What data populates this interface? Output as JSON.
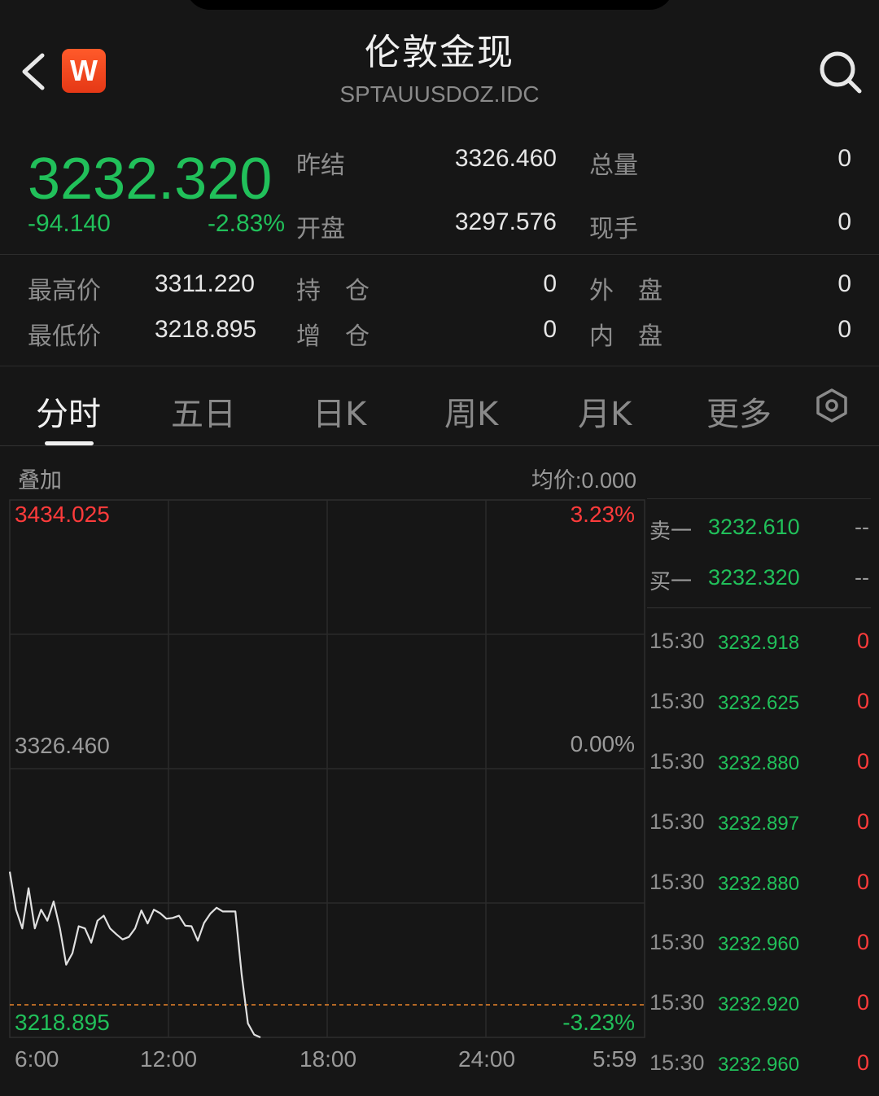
{
  "header": {
    "title": "伦敦金现",
    "subtitle": "SPTAUUSDOZ.IDC",
    "logo_letter": "W"
  },
  "quote": {
    "price": "3232.320",
    "change": "-94.140",
    "change_pct": "-2.83%",
    "fields": [
      {
        "label": "昨结",
        "value": "3326.460"
      },
      {
        "label": "总量",
        "value": "0"
      },
      {
        "label": "开盘",
        "value": "3297.576"
      },
      {
        "label": "现手",
        "value": "0"
      },
      {
        "label": "最高价",
        "value": "3311.220"
      },
      {
        "label": "持　仓",
        "value": "0"
      },
      {
        "label": "外　盘",
        "value": "0"
      },
      {
        "label": "最低价",
        "value": "3218.895"
      },
      {
        "label": "增　仓",
        "value": "0"
      },
      {
        "label": "内　盘",
        "value": "0"
      }
    ]
  },
  "tabs": [
    {
      "label": "分时",
      "active": true
    },
    {
      "label": "五日"
    },
    {
      "label": "日K"
    },
    {
      "label": "周K"
    },
    {
      "label": "月K"
    },
    {
      "label": "更多"
    }
  ],
  "chart_bar": {
    "overlay": "叠加",
    "avg_price": "均价:0.000"
  },
  "chart_data": {
    "type": "line",
    "y_high_label": "3434.025",
    "y_mid_label": "3326.460",
    "y_low_label": "3218.895",
    "pct_high_label": "3.23%",
    "pct_mid_label": "0.00%",
    "pct_low_label": "-3.23%",
    "x_ticks": [
      "6:00",
      "12:00",
      "18:00",
      "24:00",
      "5:59"
    ],
    "ylim": [
      3218.895,
      3434.025
    ],
    "reference_line": 3218.895,
    "series": [
      {
        "values": [
          3285.2,
          3270.0,
          3262.5,
          3278.6,
          3262.5,
          3270.0,
          3265.6,
          3273.3,
          3262.5,
          3248.0,
          3252.6,
          3263.4,
          3262.5,
          3256.8,
          3265.6,
          3267.6,
          3262.5,
          3260.2,
          3258.1,
          3259.1,
          3262.5,
          3269.7,
          3264.5,
          3270.0,
          3268.6,
          3266.4,
          3266.7,
          3267.6,
          3263.6,
          3263.4,
          3257.6,
          3264.7,
          3268.4,
          3270.8,
          3269.3,
          3269.3,
          3269.3,
          3244.1,
          3224.5,
          3220.0,
          3218.9
        ]
      }
    ]
  },
  "orderbook": {
    "asks": [
      {
        "label": "卖一",
        "price": "3232.610",
        "vol": "--"
      }
    ],
    "bids": [
      {
        "label": "买一",
        "price": "3232.320",
        "vol": "--"
      }
    ]
  },
  "ticks": [
    {
      "time": "15:30",
      "price": "3232.918",
      "vol": "0"
    },
    {
      "time": "15:30",
      "price": "3232.625",
      "vol": "0"
    },
    {
      "time": "15:30",
      "price": "3232.880",
      "vol": "0"
    },
    {
      "time": "15:30",
      "price": "3232.897",
      "vol": "0"
    },
    {
      "time": "15:30",
      "price": "3232.880",
      "vol": "0"
    },
    {
      "time": "15:30",
      "price": "3232.960",
      "vol": "0"
    },
    {
      "time": "15:30",
      "price": "3232.920",
      "vol": "0"
    },
    {
      "time": "15:30",
      "price": "3232.960",
      "vol": "0"
    }
  ],
  "colors": {
    "up": "#ff3b3b",
    "down": "#21c05a",
    "line": "#e0e0e0",
    "ref": "#e8832a"
  }
}
